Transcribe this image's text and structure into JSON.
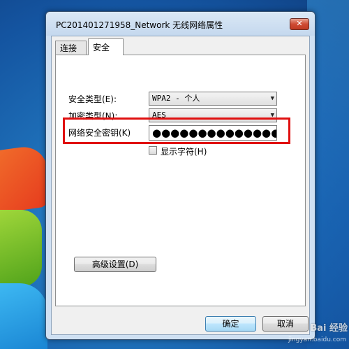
{
  "window": {
    "title": "PC201401271958_Network 无线网络属性",
    "close_glyph": "✕"
  },
  "tabs": [
    {
      "label": "连接"
    },
    {
      "label": "安全"
    }
  ],
  "security": {
    "security_type_label": "安全类型(E):",
    "security_type_value": "WPA2 - 个人",
    "encryption_type_label": "加密类型(N):",
    "encryption_type_value": "AES",
    "network_key_label": "网络安全密钥(K)",
    "network_key_value": "●●●●●●●●●●●●●●",
    "show_chars_label": "显示字符(H)",
    "show_chars_checked": false,
    "advanced_button": "高级设置(D)"
  },
  "buttons": {
    "ok": "确定",
    "cancel": "取消"
  },
  "watermark": {
    "brand": "Bai 经验",
    "url": "jingyan.baidu.com"
  },
  "colors": {
    "highlight": "#e01010",
    "desktop": "#1e6fb8"
  }
}
